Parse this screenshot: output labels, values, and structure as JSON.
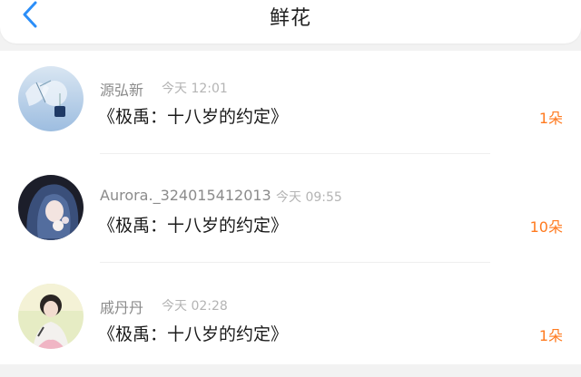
{
  "header": {
    "title": "鲜花",
    "back_icon": "chevron-left-icon"
  },
  "colors": {
    "accent": "#2b8ef8",
    "count": "#ff7a1f",
    "name": "#8b8b8b",
    "time": "#b4b4b4"
  },
  "items": [
    {
      "name": "源弘新",
      "time": "今天 12:01",
      "book": "《极禹：十八岁的约定》",
      "count": "1朵"
    },
    {
      "name": "Aurora._324015412013",
      "time": "今天 09:55",
      "book": "《极禹：十八岁的约定》",
      "count": "10朵"
    },
    {
      "name": "戚丹丹",
      "time": "今天 02:28",
      "book": "《极禹：十八岁的约定》",
      "count": "1朵"
    }
  ]
}
